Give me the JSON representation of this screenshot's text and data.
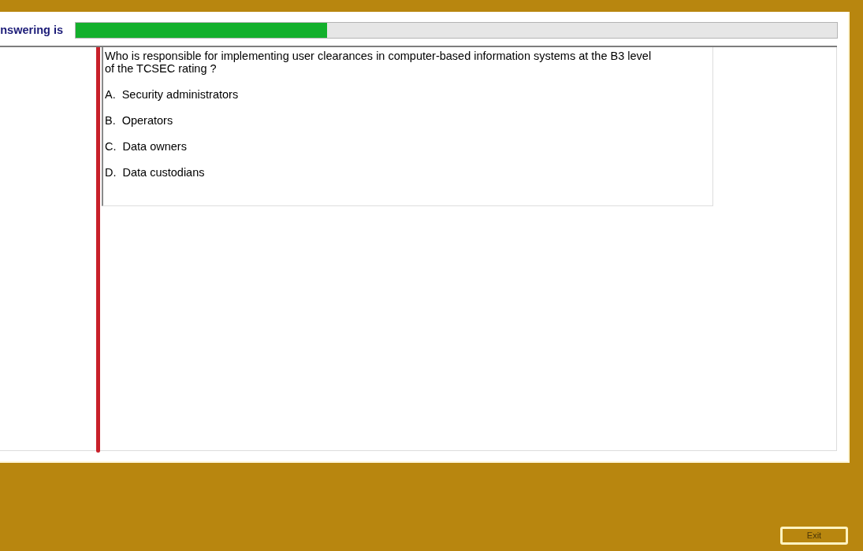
{
  "header": {
    "label": "nswering is",
    "progress": {
      "level": 0.33
    }
  },
  "question": {
    "text": "Who is responsible for implementing user clearances in computer-based information systems at the B3 level of the TCSEC rating ?",
    "options": [
      {
        "letter": "A.",
        "text": "Security administrators"
      },
      {
        "letter": "B.",
        "text": "Operators"
      },
      {
        "letter": "C.",
        "text": "Data owners"
      },
      {
        "letter": "D.",
        "text": "Data custodians"
      }
    ]
  },
  "footer": {
    "buttons": [
      {
        "label": "Exit"
      }
    ]
  }
}
